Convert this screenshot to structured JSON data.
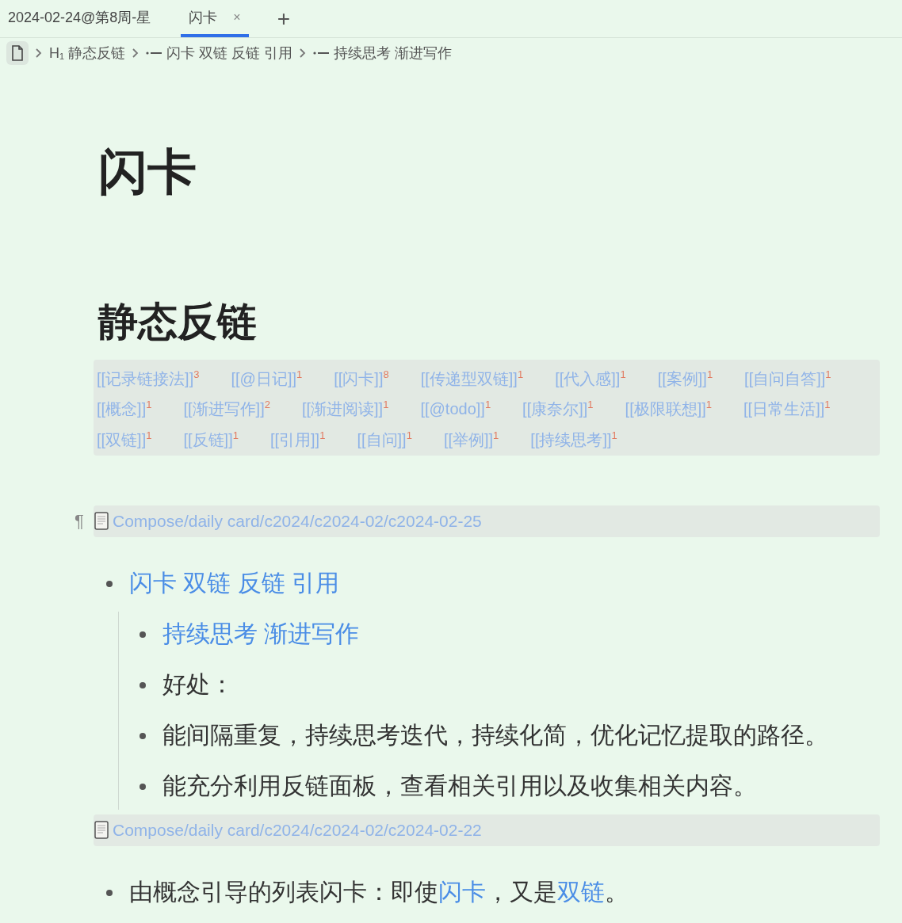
{
  "tabs": [
    {
      "label": "2024-02-24@第8周-星",
      "selected": false
    },
    {
      "label": "闪卡",
      "selected": true,
      "close": "×"
    }
  ],
  "new_tab": "+",
  "breadcrumb": [
    {
      "kind": "heading",
      "text": "H₁ 静态反链"
    },
    {
      "kind": "list",
      "text": "闪卡 双链 反链 引用"
    },
    {
      "kind": "list",
      "text": "持续思考 渐进写作"
    }
  ],
  "title": "闪卡",
  "heading": "静态反链",
  "tags": [
    {
      "text": "[[记录链接法]]",
      "count": "3"
    },
    {
      "text": "[[@日记]]",
      "count": "1"
    },
    {
      "text": "[[闪卡]]",
      "count": "8"
    },
    {
      "text": "[[传递型双链]]",
      "count": "1"
    },
    {
      "text": "[[代入感]]",
      "count": "1"
    },
    {
      "text": "[[案例]]",
      "count": "1"
    },
    {
      "text": "[[自问自答]]",
      "count": "1"
    },
    {
      "text": "[[概念]]",
      "count": "1"
    },
    {
      "text": "[[渐进写作]]",
      "count": "2"
    },
    {
      "text": "[[渐进阅读]]",
      "count": "1"
    },
    {
      "text": "[[@todo]]",
      "count": "1"
    },
    {
      "text": "[[康奈尔]]",
      "count": "1"
    },
    {
      "text": "[[极限联想]]",
      "count": "1"
    },
    {
      "text": "[[日常生活]]",
      "count": "1"
    },
    {
      "text": "[[双链]]",
      "count": "1"
    },
    {
      "text": "[[反链]]",
      "count": "1"
    },
    {
      "text": "[[引用]]",
      "count": "1"
    },
    {
      "text": "[[自问]]",
      "count": "1"
    },
    {
      "text": "[[举例]]",
      "count": "1"
    },
    {
      "text": "[[持续思考]]",
      "count": "1"
    }
  ],
  "blocks": [
    {
      "kind": "embed",
      "pilcrow": "¶",
      "path": "Compose/daily card/c2024/c2024-02/c2024-02-25"
    },
    {
      "kind": "list",
      "items": [
        {
          "segments": [
            {
              "kind": "link",
              "text": "闪卡 双链 反链 引用"
            }
          ],
          "children": [
            {
              "segments": [
                {
                  "kind": "link",
                  "text": "持续思考 渐进写作"
                }
              ]
            },
            {
              "segments": [
                {
                  "kind": "plain",
                  "text": "好处："
                }
              ]
            },
            {
              "segments": [
                {
                  "kind": "plain",
                  "text": "能间隔重复，持续思考迭代，持续化简，优化记忆提取的路径。"
                }
              ]
            },
            {
              "segments": [
                {
                  "kind": "plain",
                  "text": "能充分利用反链面板，查看相关引用以及收集相关内容。"
                }
              ]
            }
          ]
        }
      ]
    },
    {
      "kind": "embed",
      "path": "Compose/daily card/c2024/c2024-02/c2024-02-22"
    },
    {
      "kind": "list",
      "items": [
        {
          "segments": [
            {
              "kind": "plain",
              "text": "由概念引导的列表闪卡：即使"
            },
            {
              "kind": "link",
              "text": "闪卡"
            },
            {
              "kind": "plain",
              "text": "，又是"
            },
            {
              "kind": "link",
              "text": "双链"
            },
            {
              "kind": "plain",
              "text": "。"
            }
          ]
        }
      ]
    }
  ]
}
